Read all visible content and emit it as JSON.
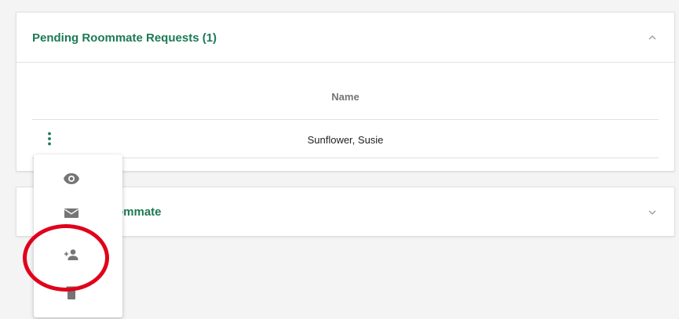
{
  "colors": {
    "brand_green": "#1b7a55",
    "annotation_red": "#e0001b"
  },
  "pending_panel": {
    "title": "Pending Roommate Requests (1)",
    "toggle_icon": "chevron-up-icon",
    "table": {
      "columns": [
        "Name"
      ],
      "rows": [
        {
          "name": "Sunflower, Susie",
          "menu_icon": "kebab-menu-icon"
        }
      ]
    }
  },
  "add_panel": {
    "title": "ommate",
    "toggle_icon": "chevron-down-icon"
  },
  "action_menu": {
    "items": [
      {
        "icon": "eye-icon"
      },
      {
        "icon": "envelope-icon"
      },
      {
        "icon": "add-person-icon"
      },
      {
        "icon": "trash-icon"
      }
    ]
  },
  "annotation": {
    "type": "circle",
    "target": "add-person-icon"
  }
}
